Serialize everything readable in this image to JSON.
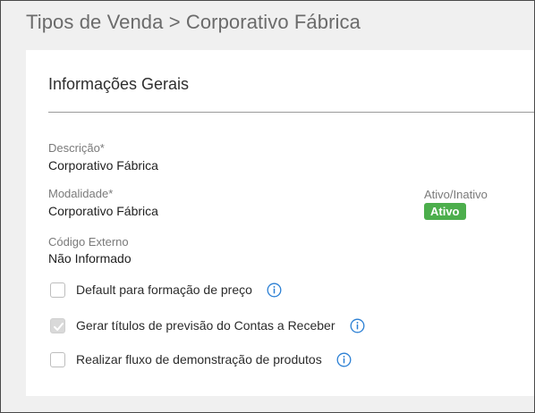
{
  "header": {
    "title": "Tipos de Venda > Corporativo Fábrica"
  },
  "section": {
    "title": "Informações Gerais"
  },
  "fields": {
    "descricao": {
      "label": "Descrição*",
      "value": "Corporativo Fábrica"
    },
    "modalidade": {
      "label": "Modalidade*",
      "value": "Corporativo Fábrica"
    },
    "codigo_externo": {
      "label": "Código Externo",
      "value": "Não Informado"
    },
    "status": {
      "label": "Ativo/Inativo",
      "value": "Ativo"
    }
  },
  "options": [
    {
      "label": "Default para formação de preço",
      "checked": false,
      "disabled": false,
      "icon": "info-icon"
    },
    {
      "label": "Gerar títulos de previsão do Contas a Receber",
      "checked": true,
      "disabled": true,
      "icon": "info-icon"
    },
    {
      "label": "Realizar fluxo de demonstração de produtos",
      "checked": false,
      "disabled": false,
      "icon": "info-icon"
    }
  ],
  "colors": {
    "background": "#f0f0f0",
    "card": "#ffffff",
    "active_badge": "#4cae4c",
    "info_icon": "#2a7fd4"
  }
}
